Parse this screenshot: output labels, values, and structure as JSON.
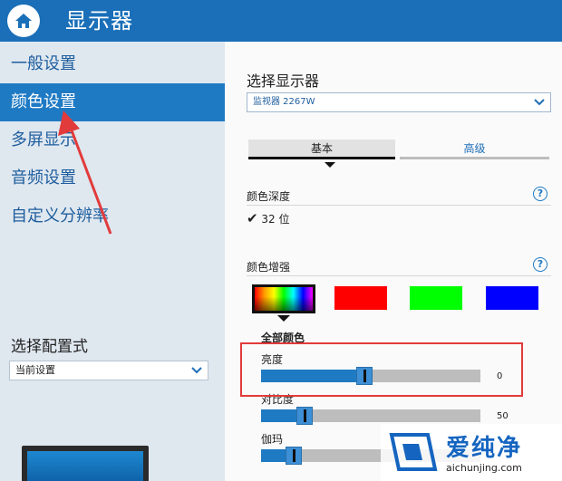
{
  "header": {
    "title": "显示器"
  },
  "sidebar": {
    "items": [
      {
        "label": "一般设置"
      },
      {
        "label": "颜色设置",
        "active": true
      },
      {
        "label": "多屏显示"
      },
      {
        "label": "音频设置"
      },
      {
        "label": "自定义分辨率"
      }
    ],
    "profile": {
      "label": "选择配置式",
      "value": "当前设置"
    }
  },
  "main": {
    "display_select": {
      "label": "选择显示器",
      "value": "监视器 2267W"
    },
    "tabs": [
      {
        "label": "基本",
        "active": true
      },
      {
        "label": "高级"
      }
    ],
    "color_depth": {
      "label": "颜色深度",
      "value": "32 位"
    },
    "color_enhance": {
      "label": "颜色增强",
      "swatches": [
        "all",
        "red",
        "green",
        "blue"
      ],
      "selected_label": "全部颜色"
    },
    "sliders": [
      {
        "label": "亮度",
        "value": "0",
        "level": 0.47
      },
      {
        "label": "对比度",
        "value": "50",
        "level": 0.2
      },
      {
        "label": "伽玛",
        "value": "",
        "level": 0.15
      }
    ]
  },
  "watermark": {
    "brand": "爱纯净",
    "url": "aichunjing.com"
  },
  "colors": {
    "accent": "#1f7ac4",
    "header": "#1a6fb8",
    "highlight": "#e23b3b"
  }
}
